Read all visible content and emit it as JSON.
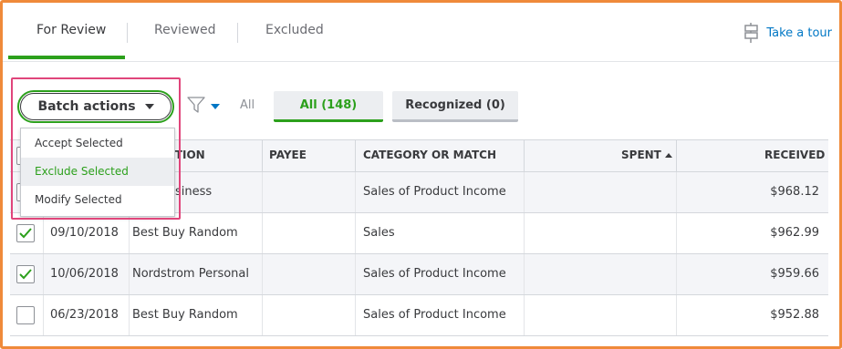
{
  "tabs": {
    "for_review": "For Review",
    "reviewed": "Reviewed",
    "excluded": "Excluded",
    "take_tour": "Take a tour"
  },
  "toolbar": {
    "batch_actions": "Batch actions",
    "all_link": "All",
    "all_pill": "All (148)",
    "recognized_pill": "Recognized (0)"
  },
  "dropdown": {
    "items": [
      "Accept Selected",
      "Exclude Selected",
      "Modify Selected"
    ],
    "hovered_index": 1
  },
  "table": {
    "headers": {
      "description": "PTION",
      "payee": "PAYEE",
      "category": "CATEGORY OR MATCH",
      "spent": "SPENT",
      "received": "RECEIVED"
    },
    "rows": [
      {
        "checked": false,
        "date": "",
        "description": "rom Business",
        "payee": "",
        "category": "Sales of Product Income",
        "spent": "",
        "received": "$968.12"
      },
      {
        "checked": true,
        "date": "09/10/2018",
        "description": "Best Buy Random",
        "payee": "",
        "category": "Sales",
        "spent": "",
        "received": "$962.99"
      },
      {
        "checked": true,
        "date": "10/06/2018",
        "description": "Nordstrom Personal",
        "payee": "",
        "category": "Sales of Product Income",
        "spent": "",
        "received": "$959.66"
      },
      {
        "checked": false,
        "date": "06/23/2018",
        "description": "Best Buy Random",
        "payee": "",
        "category": "Sales of Product Income",
        "spent": "",
        "received": "$952.88"
      }
    ]
  },
  "colors": {
    "accent_green": "#2ca01c",
    "link_blue": "#0077c5",
    "highlight_pink": "#e0457b",
    "frame_orange": "#ef8a3a"
  }
}
